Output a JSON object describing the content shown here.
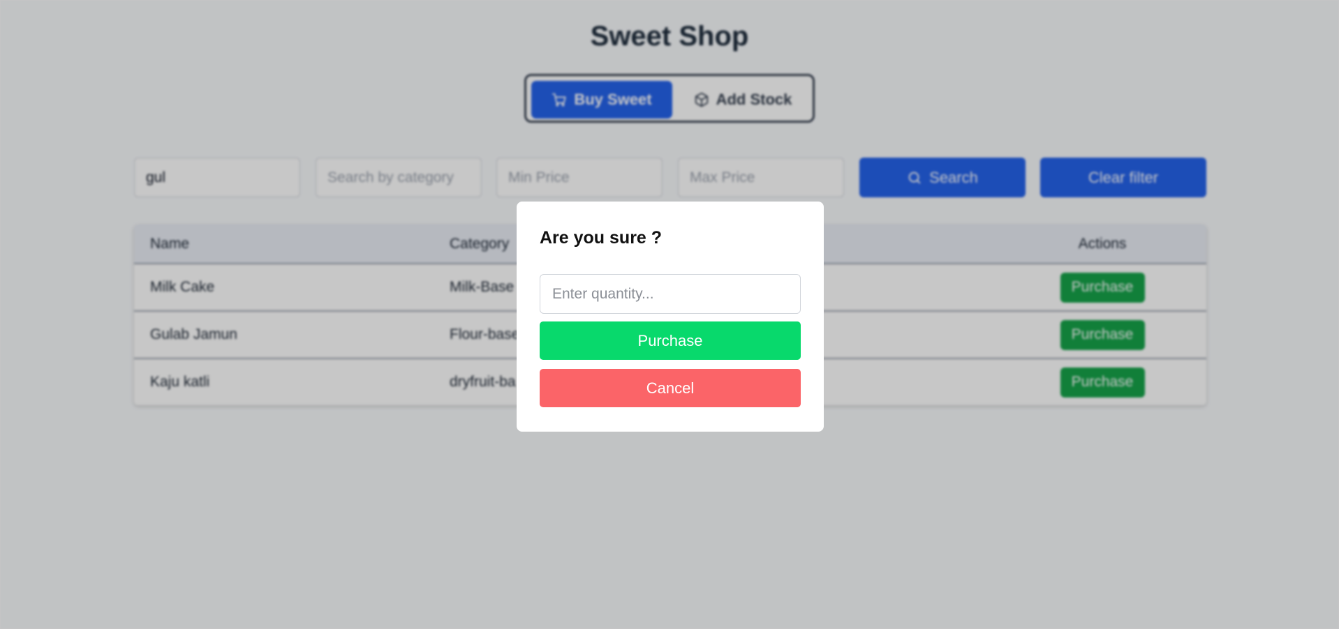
{
  "app": {
    "title": "Sweet Shop"
  },
  "mode_toggle": {
    "buy_label": "Buy Sweet",
    "add_label": "Add Stock",
    "active": "Buy Sweet"
  },
  "filters": {
    "name_value": "gul",
    "category_placeholder": "Search by category",
    "min_price_placeholder": "Min Price",
    "max_price_placeholder": "Max Price",
    "search_label": "Search",
    "clear_label": "Clear filter"
  },
  "table": {
    "columns": [
      "Name",
      "Category",
      "Actions"
    ],
    "rows": [
      {
        "name": "Milk Cake",
        "category": "Milk-Base",
        "action": "Purchase"
      },
      {
        "name": "Gulab Jamun",
        "category": "Flour-base",
        "action": "Purchase"
      },
      {
        "name": "Kaju katli",
        "category": "dryfruit-ba",
        "action": "Purchase"
      }
    ]
  },
  "modal": {
    "title": "Are you sure ?",
    "quantity_placeholder": "Enter quantity...",
    "purchase_label": "Purchase",
    "cancel_label": "Cancel"
  },
  "colors": {
    "primary_blue": "#2563eb",
    "row_purchase_green": "#16a34a",
    "modal_purchase_green": "#08d96c",
    "cancel_red": "#fb6468"
  }
}
